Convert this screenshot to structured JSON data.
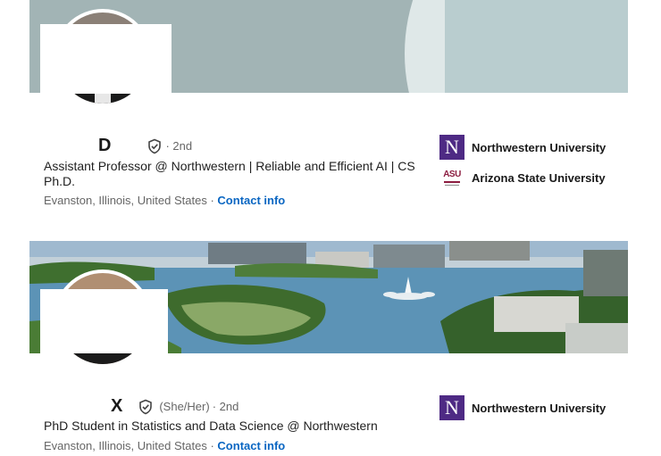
{
  "profiles": [
    {
      "name": "D",
      "pronouns": "",
      "degree": "· 2nd",
      "headline": "Assistant Professor @ Northwestern | Reliable and Efficient AI | CS Ph.D.",
      "location": "Evanston, Illinois, United States",
      "separator": "·",
      "contact_label": "Contact info",
      "organizations": [
        {
          "name": "Northwestern University",
          "logo": "northwestern-N"
        },
        {
          "name": "Arizona State University",
          "logo": "ASU"
        }
      ]
    },
    {
      "name": "X",
      "pronouns": "(She/Her)",
      "degree": "· 2nd",
      "headline": "PhD Student in Statistics and Data Science @ Northwestern",
      "location": "Evanston, Illinois, United States",
      "separator": "·",
      "contact_label": "Contact info",
      "organizations": [
        {
          "name": "Northwestern University",
          "logo": "northwestern-N"
        }
      ]
    }
  ],
  "logos": {
    "northwestern_letter": "N",
    "asu_letters": "ASU"
  },
  "colors": {
    "link": "#0a66c2",
    "northwestern_purple": "#4e2a84",
    "asu_maroon": "#8c1d40",
    "muted_text": "#666666"
  }
}
